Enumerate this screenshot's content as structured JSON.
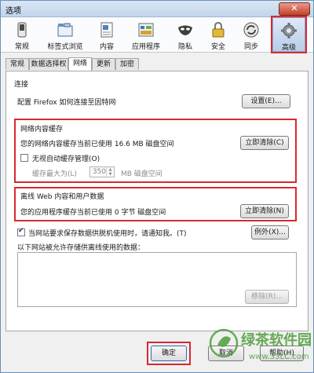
{
  "window": {
    "title": "选项",
    "close_glyph": "✕"
  },
  "toolbar": {
    "items": [
      {
        "label": "常规",
        "icon": "switch-icon"
      },
      {
        "label": "标签式浏览",
        "icon": "tabs-icon"
      },
      {
        "label": "内容",
        "icon": "page-icon"
      },
      {
        "label": "应用程序",
        "icon": "applications-icon"
      },
      {
        "label": "隐私",
        "icon": "mask-icon"
      },
      {
        "label": "安全",
        "icon": "lock-icon"
      },
      {
        "label": "同步",
        "icon": "sync-icon"
      },
      {
        "label": "高级",
        "icon": "gear-icon",
        "active": true
      }
    ]
  },
  "tabs": [
    "常规",
    "数据选择权",
    "网络",
    "更新",
    "加密"
  ],
  "active_tab": "网络",
  "connection": {
    "heading": "连接",
    "description": "配置 Firefox 如何连接至因特网",
    "settings_button": "设置(E)..."
  },
  "cache": {
    "heading": "网络内容缓存",
    "usage_text": "您的网络内容缓存当前已使用 16.6 MB 磁盘空间",
    "clear_button": "立即清除(C)",
    "override_label": "无视自动缓存管理(O)",
    "limit_label": "缓存最大为(L)",
    "limit_value": "350",
    "limit_unit": "MB 磁盘空间"
  },
  "offline": {
    "heading": "离线 Web 内容和用户数据",
    "usage_text": "您的应用程序缓存当前已使用 0 字节 磁盘空间",
    "clear_button": "立即清除(N)",
    "notify_label": "当网站要求保存数据供脱机使用时，请通知我。(T)",
    "exceptions_button": "例外(X)...",
    "allowed_label": "以下网站被允许存储供离线使用的数据：",
    "remove_button": "移除(R)..."
  },
  "footer": {
    "ok": "确定",
    "cancel": "取消",
    "help": "帮助(H)"
  },
  "watermark": {
    "brand": "绿茶软件园",
    "url": "www.33LC.com"
  },
  "colors": {
    "highlight": "#d8292f",
    "accent": "#2c6fb5",
    "watermark": "#4d9d3a"
  }
}
